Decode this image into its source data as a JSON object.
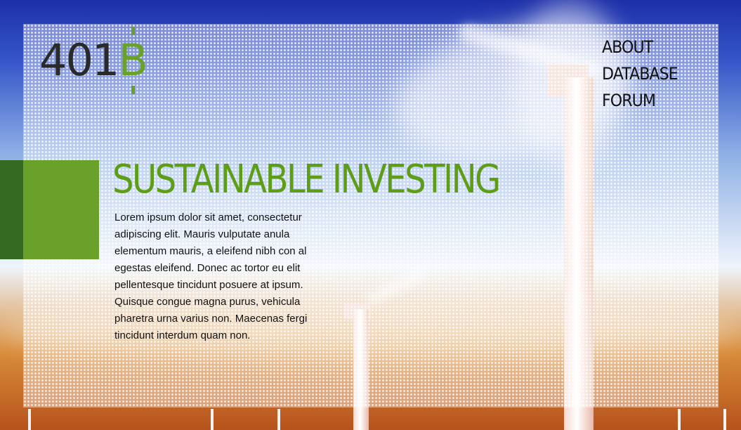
{
  "brand": {
    "logo_digits": "401",
    "logo_symbol": "B",
    "accent_color": "#6aa12a"
  },
  "nav": {
    "items": [
      {
        "label": "ABOUT"
      },
      {
        "label": "DATABASE"
      },
      {
        "label": "FORUM"
      }
    ]
  },
  "hero": {
    "title": "SUSTAINABLE INVESTING",
    "body": "Lorem ipsum dolor sit amet, consectetur adipiscing elit. Mauris vulputate anula elementum mauris, a eleifend nibh con al egestas eleifend. Donec ac tortor eu elit pellentesque tincidunt posuere at ipsum. Quisque congue magna purus, vehicula pharetra urna varius non. Maecenas fergi tincidunt interdum quam non."
  },
  "background": {
    "subject": "wind-turbines-photo"
  }
}
